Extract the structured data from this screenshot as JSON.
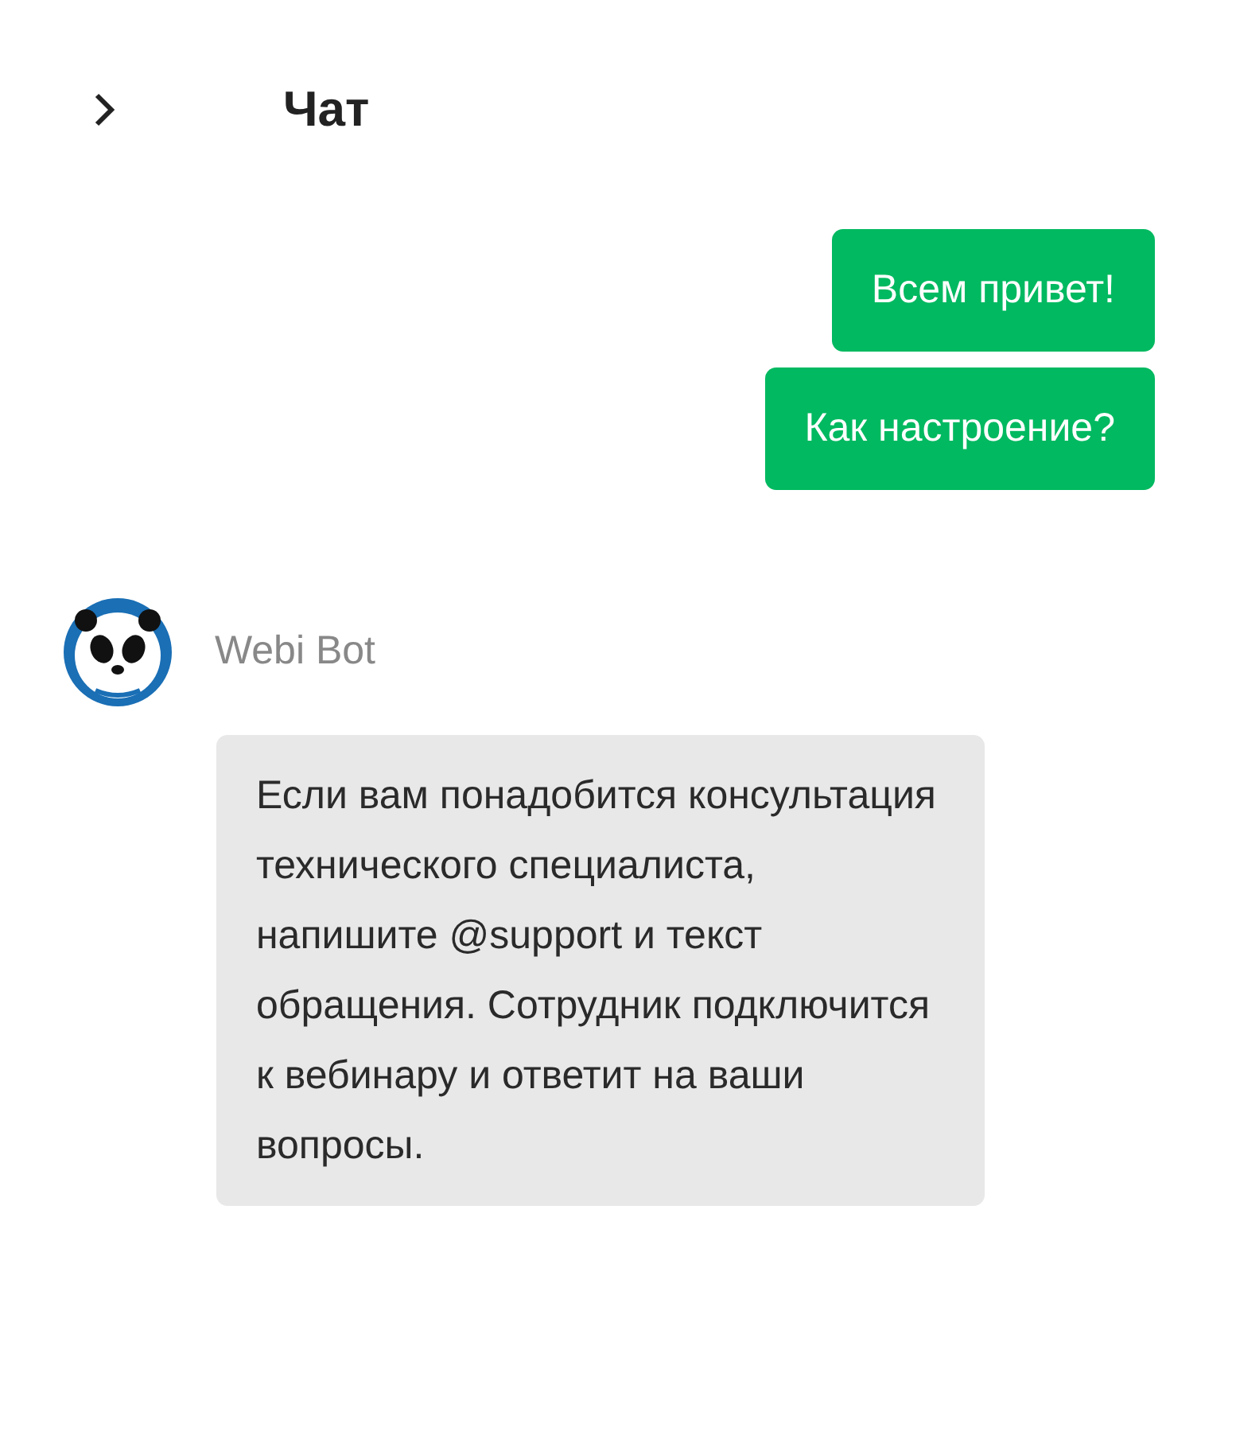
{
  "header": {
    "title": "Чат"
  },
  "messages": [
    {
      "kind": "outgoing",
      "text": "Всем привет!"
    },
    {
      "kind": "outgoing",
      "text": "Как настроение?"
    },
    {
      "kind": "incoming",
      "author": "Webi Bot",
      "text": "Если вам понадобится консультация технического специалиста, напишите @support и текст обращения. Сотрудник подключится к вебинару и ответит на ваши вопросы."
    }
  ]
}
